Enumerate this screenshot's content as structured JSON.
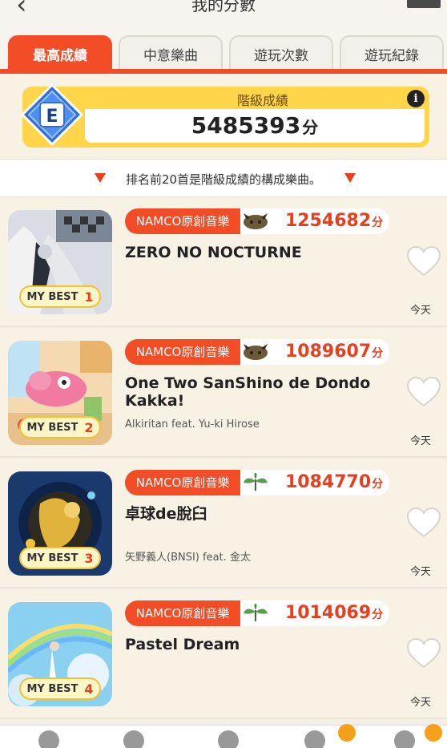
{
  "header": {
    "title": "我的分數",
    "back_glyph": "‹"
  },
  "tabs": [
    {
      "label": "最高成績",
      "active": true
    },
    {
      "label": "中意樂曲",
      "active": false
    },
    {
      "label": "遊玩次數",
      "active": false
    },
    {
      "label": "遊玩紀錄",
      "active": false
    }
  ],
  "rank": {
    "grade": "E",
    "label": "階級成績",
    "value": "5485393",
    "unit": "分",
    "info": "i"
  },
  "notice": {
    "text": "排名前20首是階級成績的構成樂曲。"
  },
  "songs": [
    {
      "genre": "NAMCO原創音樂",
      "difficulty_icon": "oni-icon",
      "score": "1254682",
      "unit": "分",
      "title": "ZERO NO NOCTURNE",
      "artist": "",
      "mybest": "MY BEST",
      "rank": "1",
      "date": "今天"
    },
    {
      "genre": "NAMCO原創音樂",
      "difficulty_icon": "oni-icon",
      "score": "1089607",
      "unit": "分",
      "title": "One Two SanShino de Dondo Kakka!",
      "artist": "Alkiritan feat. Yu-ki Hirose",
      "mybest": "MY BEST",
      "rank": "2",
      "date": "今天"
    },
    {
      "genre": "NAMCO原創音樂",
      "difficulty_icon": "leaf-icon",
      "score": "1084770",
      "unit": "分",
      "title": "卓球de脫臼",
      "artist": "矢野義人(BNSI) feat. 金太",
      "mybest": "MY BEST",
      "rank": "3",
      "date": "今天"
    },
    {
      "genre": "NAMCO原創音樂",
      "difficulty_icon": "leaf-icon",
      "score": "1014069",
      "unit": "分",
      "title": "Pastel Dream",
      "artist": "",
      "mybest": "MY BEST",
      "rank": "4",
      "date": "今天"
    }
  ],
  "colors": {
    "accent": "#f24d27",
    "score": "#e8401f",
    "gold": "#ffd54a",
    "row_bg": "#f8f2e4"
  }
}
